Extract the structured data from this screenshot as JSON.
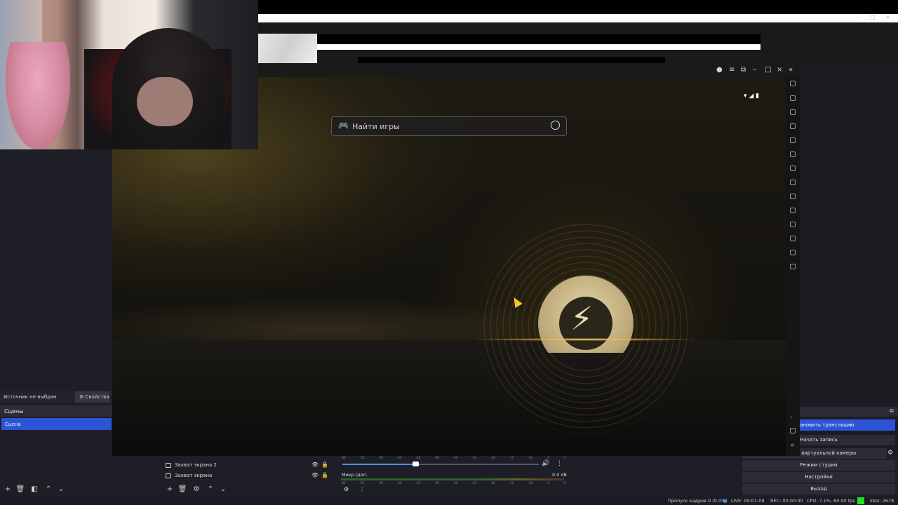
{
  "launcher": {
    "search_placeholder": "Найти игры",
    "window_controls": [
      "user-icon",
      "menu-icon",
      "pip-icon",
      "minimize-icon",
      "maximize-icon",
      "close-icon",
      "collapse-icon"
    ],
    "accent_color": "#d9b65a"
  },
  "obs": {
    "source_status": "Источник не выбран",
    "properties_label": "Свойства",
    "scenes_header": "Сцены",
    "scenes": [
      "Сцена"
    ],
    "sources": [
      {
        "name": "Захват экрана 2"
      },
      {
        "name": "Захват экрана"
      }
    ],
    "mixer": {
      "channel_name": "Микр./доп.",
      "channel_level": "0.0 dB",
      "scale": [
        "-60",
        "-55",
        "-50",
        "-45",
        "-40",
        "-35",
        "-30",
        "-25",
        "-20",
        "-15",
        "-10",
        "-5",
        "0"
      ]
    },
    "controls": {
      "stream": "Остановить трансляцию",
      "record": "Начать запись",
      "virtual_cam": "Запустить виртуальной камеры",
      "studio": "Режим студии",
      "settings": "Настройки",
      "exit": "Выход"
    },
    "status": {
      "dropped": "Пропуск кадров 0 (0.0%)",
      "live": "LIVE: 00:01:09",
      "rec": "REC: 00:00:00",
      "cpu": "CPU: 7.1%, 60.00 fps",
      "bitrate": "kb/s: 2678"
    },
    "stream_label_visible": "ановить трансляцию"
  }
}
